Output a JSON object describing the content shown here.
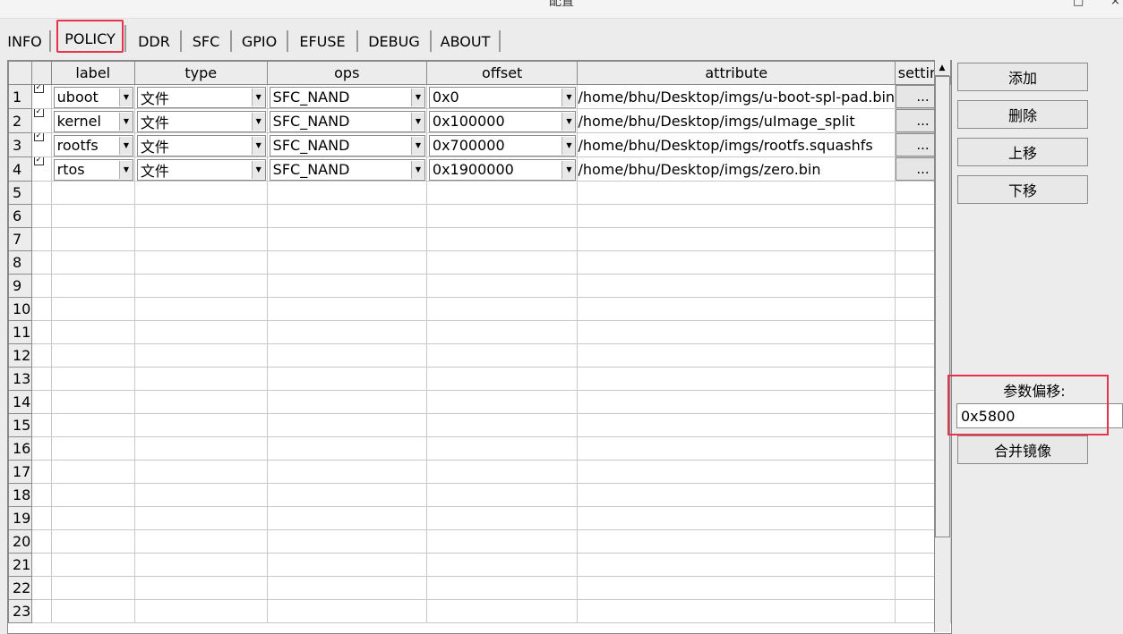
{
  "window": {
    "title": "配置",
    "maximize_glyph": "□",
    "close_glyph": "×"
  },
  "tabs": [
    {
      "label": "INFO"
    },
    {
      "label": "POLICY"
    },
    {
      "label": "DDR"
    },
    {
      "label": "SFC"
    },
    {
      "label": "GPIO"
    },
    {
      "label": "EFUSE"
    },
    {
      "label": "DEBUG"
    },
    {
      "label": "ABOUT"
    }
  ],
  "active_tab": "POLICY",
  "table": {
    "headers": {
      "label": "label",
      "type": "type",
      "ops": "ops",
      "offset": "offset",
      "attribute": "attribute",
      "setting": "setting"
    },
    "rows": [
      {
        "num": "1",
        "checked": true,
        "label": "uboot",
        "type": "文件",
        "ops": "SFC_NAND",
        "offset": "0x0",
        "attribute": "/home/bhu/Desktop/imgs/u-boot-spl-pad.bin",
        "setting": "..."
      },
      {
        "num": "2",
        "checked": true,
        "label": "kernel",
        "type": "文件",
        "ops": "SFC_NAND",
        "offset": "0x100000",
        "attribute": "/home/bhu/Desktop/imgs/uImage_split",
        "setting": "..."
      },
      {
        "num": "3",
        "checked": true,
        "label": "rootfs",
        "type": "文件",
        "ops": "SFC_NAND",
        "offset": "0x700000",
        "attribute": "/home/bhu/Desktop/imgs/rootfs.squashfs",
        "setting": "..."
      },
      {
        "num": "4",
        "checked": true,
        "label": "rtos",
        "type": "文件",
        "ops": "SFC_NAND",
        "offset": "0x1900000",
        "attribute": "/home/bhu/Desktop/imgs/zero.bin",
        "setting": "..."
      }
    ],
    "empty_rows": [
      "5",
      "6",
      "7",
      "8",
      "9",
      "10",
      "11",
      "12",
      "13",
      "14",
      "15",
      "16",
      "17",
      "18",
      "19",
      "20",
      "21",
      "22",
      "23"
    ]
  },
  "side_buttons": {
    "add": "添加",
    "delete": "删除",
    "move_up": "上移",
    "move_down": "下移"
  },
  "param_offset": {
    "label": "参数偏移:",
    "value": "0x5800"
  },
  "merge_button": "合并镜像",
  "colors": {
    "highlight": "#e8334a"
  }
}
